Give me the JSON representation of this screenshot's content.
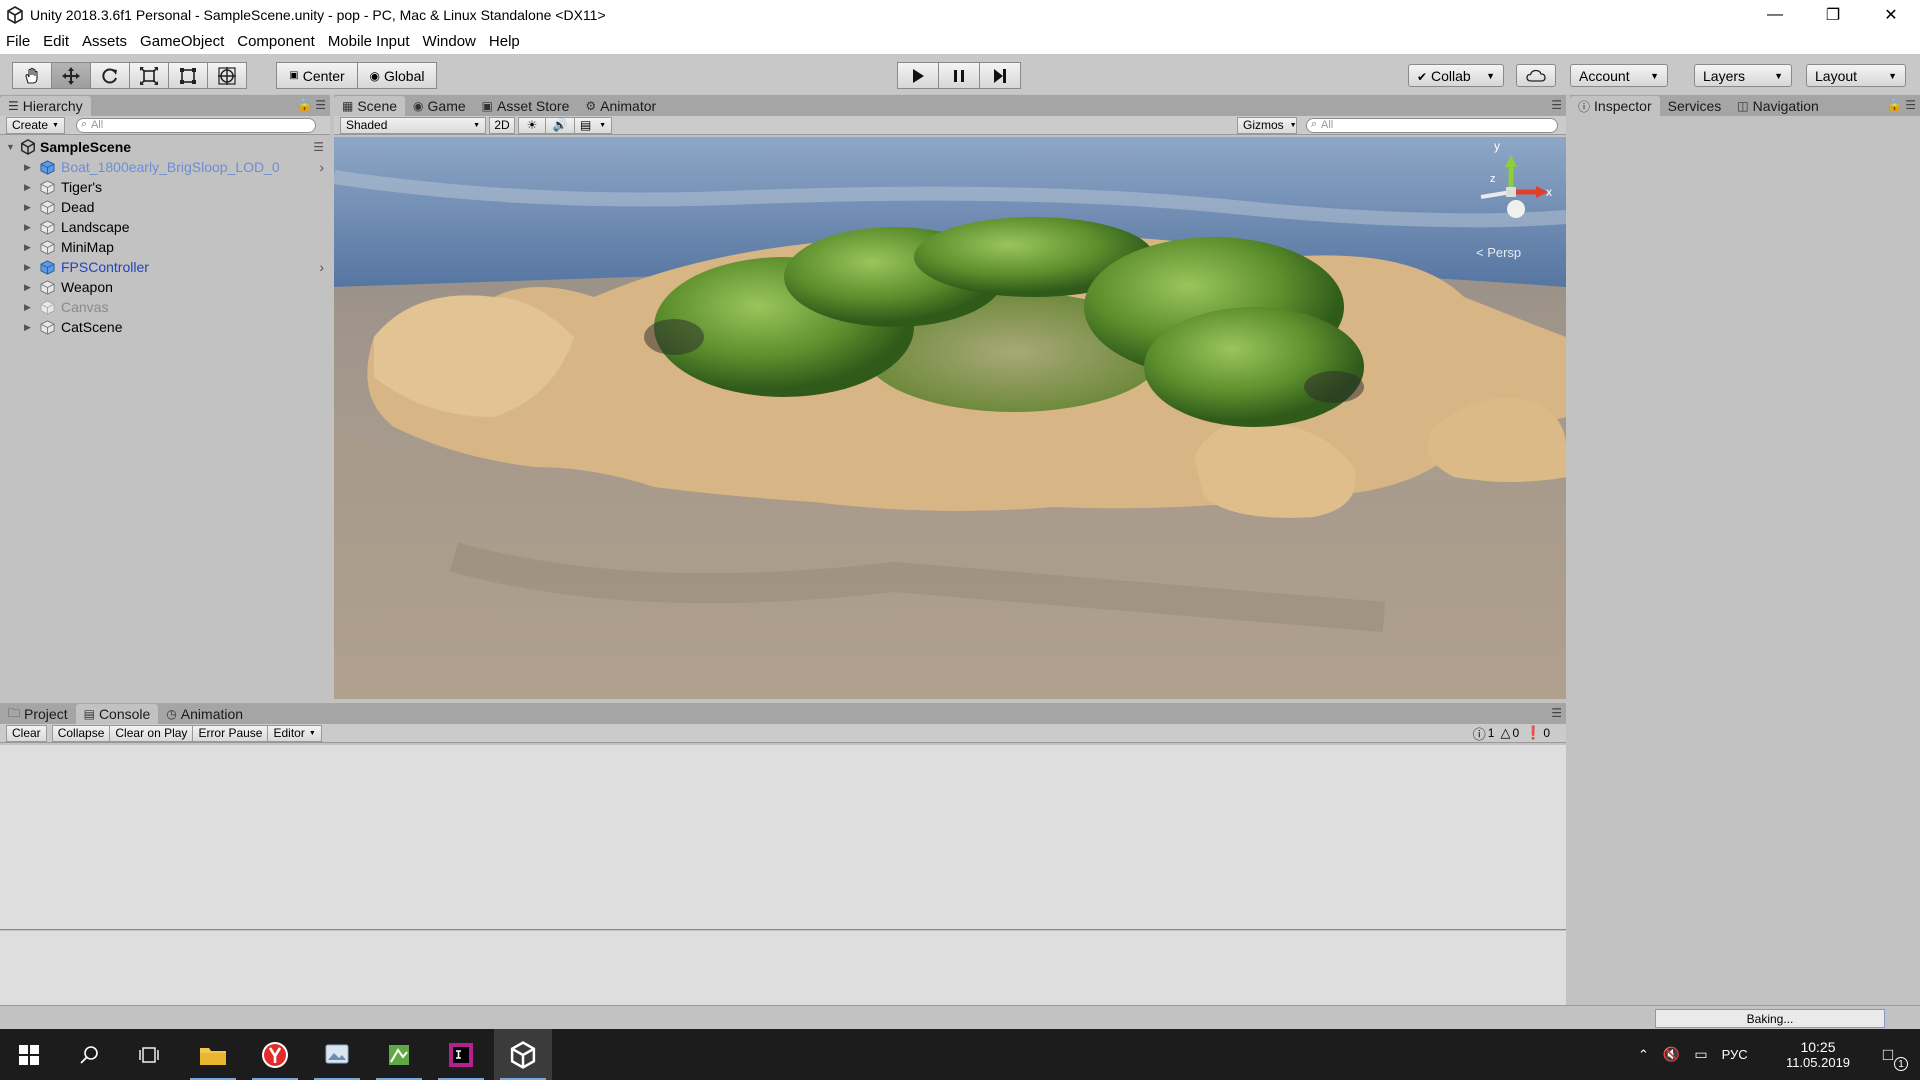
{
  "window": {
    "title": "Unity 2018.3.6f1 Personal - SampleScene.unity - pop - PC, Mac & Linux Standalone <DX11>",
    "controls": [
      "minimize",
      "restore",
      "close"
    ]
  },
  "menu": [
    "File",
    "Edit",
    "Assets",
    "GameObject",
    "Component",
    "Mobile Input",
    "Window",
    "Help"
  ],
  "toolbar": {
    "tools": [
      {
        "icon": "hand-tool-icon"
      },
      {
        "icon": "move-tool-icon",
        "active": true
      },
      {
        "icon": "rotate-tool-icon"
      },
      {
        "icon": "scale-tool-icon"
      },
      {
        "icon": "rect-tool-icon"
      },
      {
        "icon": "transform-tool-icon"
      }
    ],
    "pivot_mode": "Center",
    "pivot_rotation": "Global",
    "collab": "Collab",
    "account": "Account",
    "layers": "Layers",
    "layout": "Layout"
  },
  "hierarchy": {
    "tab": "Hierarchy",
    "create": "Create",
    "search_placeholder": "All",
    "scene": "SampleScene",
    "items": [
      {
        "label": "Boat_1800early_BrigSloop_LOD_0",
        "style": "prefab-missing",
        "has_child_arrow": true
      },
      {
        "label": "Tiger's",
        "style": "normal",
        "has_child_arrow": false
      },
      {
        "label": "Dead",
        "style": "normal",
        "has_child_arrow": false
      },
      {
        "label": "Landscape",
        "style": "normal",
        "has_child_arrow": false
      },
      {
        "label": "MiniMap",
        "style": "normal",
        "has_child_arrow": false
      },
      {
        "label": "FPSController",
        "style": "prefab",
        "has_child_arrow": true
      },
      {
        "label": "Weapon",
        "style": "normal",
        "has_child_arrow": false
      },
      {
        "label": "Canvas",
        "style": "inactive",
        "has_child_arrow": false
      },
      {
        "label": "CatScene",
        "style": "normal",
        "has_child_arrow": false
      }
    ]
  },
  "scene": {
    "tabs": [
      "Scene",
      "Game",
      "Asset Store",
      "Animator"
    ],
    "shading": "Shaded",
    "mode_2d": "2D",
    "gizmos": "Gizmos",
    "search_placeholder": "All",
    "gizmo": {
      "y": "y",
      "x": "x",
      "z": "z",
      "projection": "< Persp"
    }
  },
  "inspector": {
    "tabs": [
      "Inspector",
      "Services",
      "Navigation"
    ]
  },
  "console": {
    "tabs": [
      "Project",
      "Console",
      "Animation"
    ],
    "buttons": [
      "Clear",
      "Collapse",
      "Clear on Play",
      "Error Pause",
      "Editor"
    ],
    "counts": {
      "info": "1",
      "warnings": "0",
      "errors": "0"
    }
  },
  "status": {
    "baking": "Baking..."
  },
  "taskbar": {
    "tray_lang": "РУС",
    "time": "10:25",
    "date": "11.05.2019",
    "notifications": "1"
  },
  "colors": {
    "accent": "#2443b5",
    "taskbar": "#1c1c1c",
    "sand": "#d8b585",
    "sky": "#4f6f9d"
  }
}
